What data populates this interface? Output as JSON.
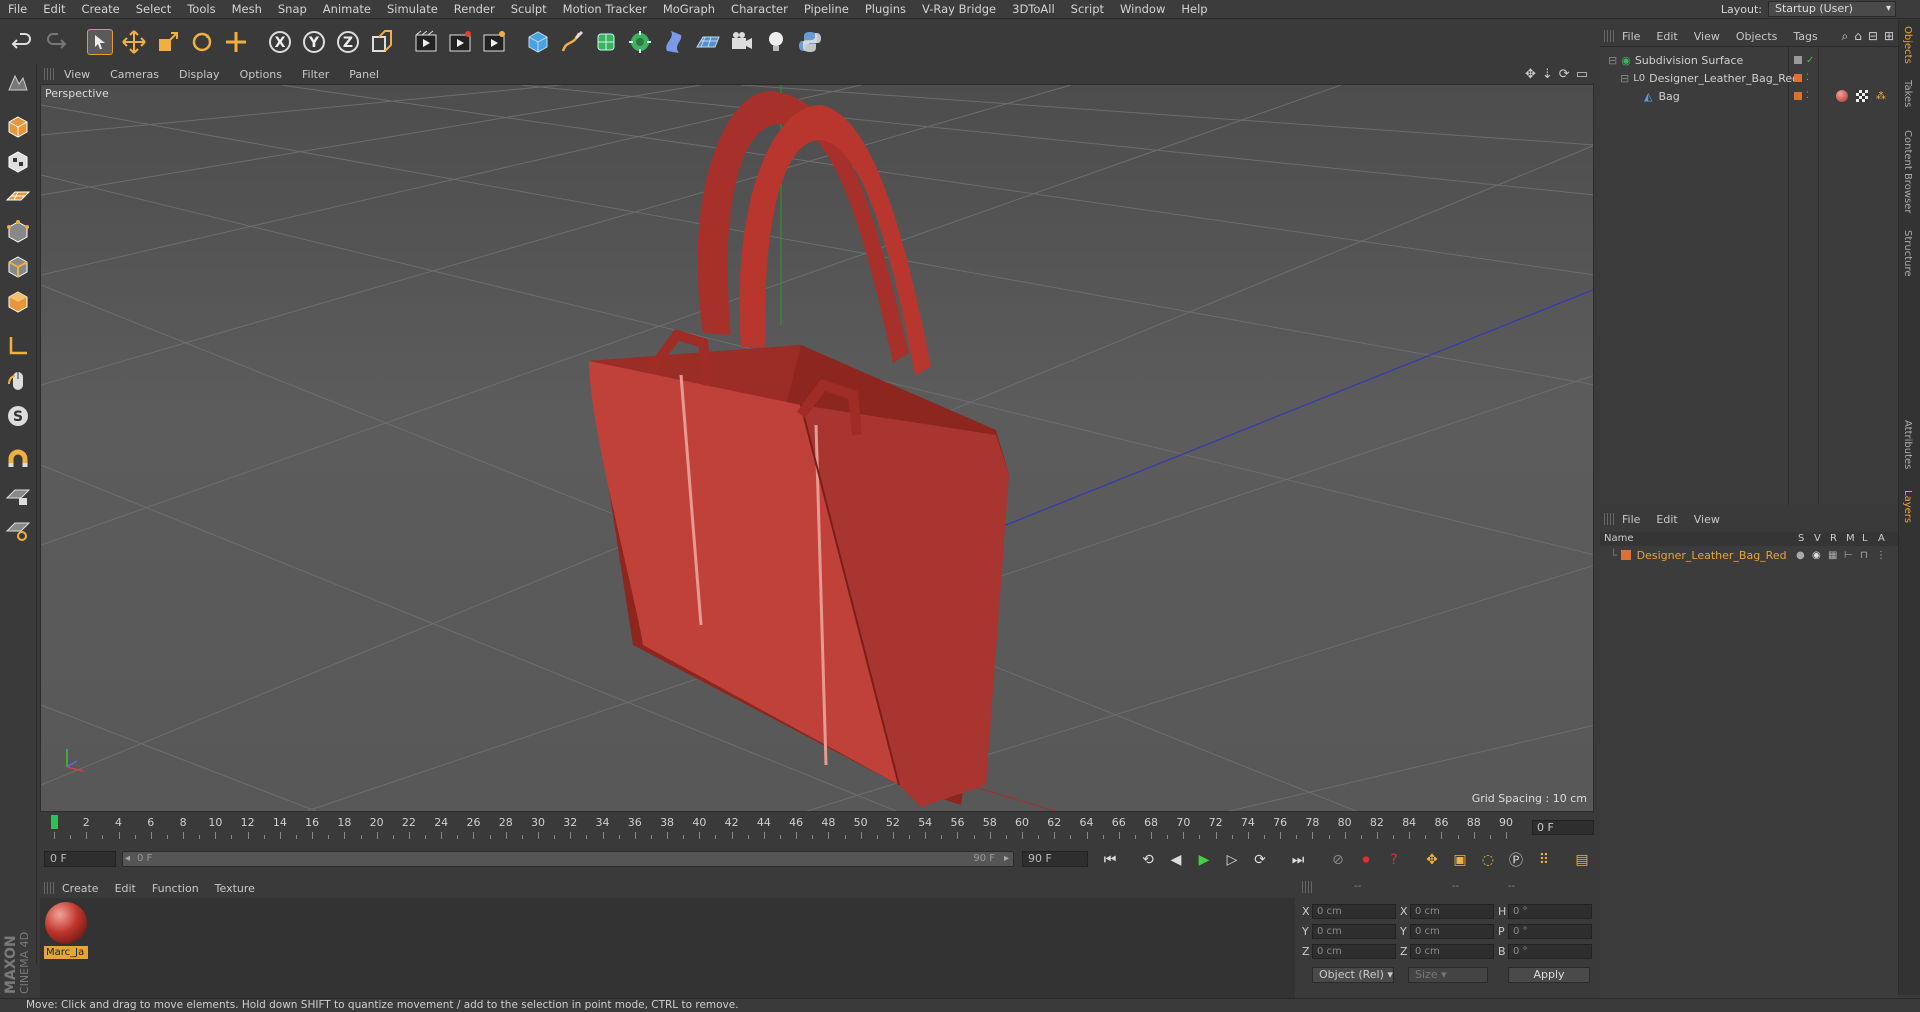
{
  "menu": [
    "File",
    "Edit",
    "Create",
    "Select",
    "Tools",
    "Mesh",
    "Snap",
    "Animate",
    "Simulate",
    "Render",
    "Sculpt",
    "Motion Tracker",
    "MoGraph",
    "Character",
    "Pipeline",
    "Plugins",
    "V-Ray Bridge",
    "3DToAll",
    "Script",
    "Window",
    "Help"
  ],
  "layout": {
    "label": "Layout:",
    "value": "Startup (User)"
  },
  "viewport": {
    "menu": [
      "View",
      "Cameras",
      "Display",
      "Options",
      "Filter",
      "Panel"
    ],
    "label": "Perspective",
    "grid_spacing": "Grid Spacing : 10 cm"
  },
  "timeline": {
    "ticks": [
      "0",
      "2",
      "4",
      "6",
      "8",
      "10",
      "12",
      "14",
      "16",
      "18",
      "20",
      "22",
      "24",
      "26",
      "28",
      "30",
      "32",
      "34",
      "36",
      "38",
      "40",
      "42",
      "44",
      "46",
      "48",
      "50",
      "52",
      "54",
      "56",
      "58",
      "60",
      "62",
      "64",
      "66",
      "68",
      "70",
      "72",
      "74",
      "76",
      "78",
      "80",
      "82",
      "84",
      "86",
      "88",
      "90"
    ],
    "current_frame": "0 F",
    "start_field": "0 F",
    "range_start": "0 F",
    "range_end": "90 F",
    "end_field": "90 F"
  },
  "material_manager": {
    "menu": [
      "Create",
      "Edit",
      "Function",
      "Texture"
    ],
    "material_name": "Marc_Ja"
  },
  "coordinates": {
    "headers": [
      "--",
      "--",
      "--"
    ],
    "rows": [
      {
        "a": "X",
        "av": "0 cm",
        "b": "X",
        "bv": "0 cm",
        "c": "H",
        "cv": "0 °"
      },
      {
        "a": "Y",
        "av": "0 cm",
        "b": "Y",
        "bv": "0 cm",
        "c": "P",
        "cv": "0 °"
      },
      {
        "a": "Z",
        "av": "0 cm",
        "b": "Z",
        "bv": "0 cm",
        "c": "B",
        "cv": "0 °"
      }
    ],
    "mode": "Object (Rel)",
    "size": "Size",
    "apply": "Apply"
  },
  "object_manager": {
    "menu": [
      "File",
      "Edit",
      "View",
      "Objects",
      "Tags"
    ],
    "objects": [
      {
        "name": "Subdivision Surface",
        "indent": 0
      },
      {
        "name": "Designer_Leather_Bag_Red",
        "indent": 1
      },
      {
        "name": "Bag",
        "indent": 2
      }
    ]
  },
  "layer_manager": {
    "menu": [
      "File",
      "Edit",
      "View"
    ],
    "columns": [
      "Name",
      "S",
      "V",
      "R",
      "M",
      "L",
      "A"
    ],
    "layers": [
      {
        "name": "Designer_Leather_Bag_Red"
      }
    ]
  },
  "right_tabs": [
    "Objects",
    "Takes",
    "Content Browser",
    "Structure",
    "Attributes",
    "Layers"
  ],
  "status": "Move: Click and drag to move elements. Hold down SHIFT to quantize movement / add to the selection in point mode, CTRL to remove.",
  "brand": {
    "line1": "MAXON",
    "line2": "CINEMA 4D"
  },
  "colors": {
    "accent": "#e8a33a",
    "bag": "#c2433a",
    "playhead": "#2cc05a"
  }
}
